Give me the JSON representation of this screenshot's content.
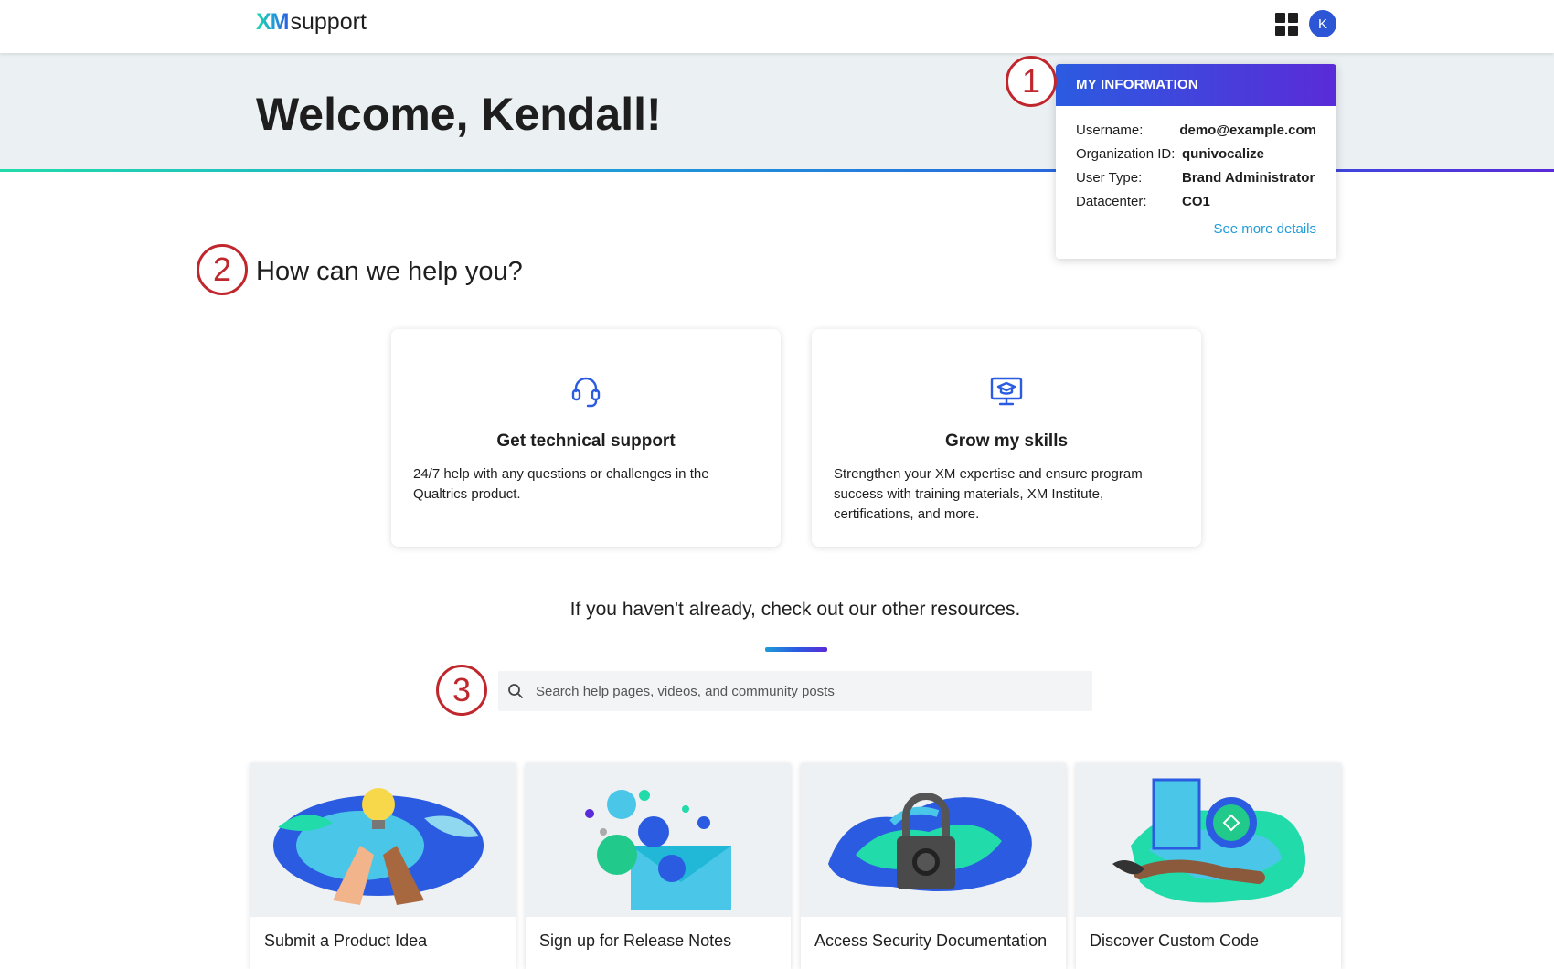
{
  "header": {
    "logo_xm": "XM",
    "logo_text": "support",
    "avatar_initial": "K"
  },
  "hero": {
    "welcome": "Welcome, Kendall!"
  },
  "my_information": {
    "title": "MY INFORMATION",
    "rows": [
      {
        "label": "Username:",
        "value": "demo@example.com"
      },
      {
        "label": "Organization ID:",
        "value": "qunivocalize"
      },
      {
        "label": "User Type:",
        "value": "Brand Administrator"
      },
      {
        "label": "Datacenter:",
        "value": "CO1"
      }
    ],
    "see_more": "See more details"
  },
  "callouts": [
    "1",
    "2",
    "3"
  ],
  "help": {
    "title": "How can we help you?",
    "cards": [
      {
        "title": "Get technical support",
        "desc": "24/7 help with any questions or challenges in the Qualtrics product.",
        "icon": "headset-icon"
      },
      {
        "title": "Grow my skills",
        "desc": "Strengthen your XM expertise and ensure program success with training materials, XM Institute, certifications, and more.",
        "icon": "training-monitor-icon"
      }
    ]
  },
  "resources": {
    "heading": "If you haven't already, check out our other resources.",
    "search_placeholder": "Search help pages, videos, and community posts",
    "tiles": [
      {
        "label": "Submit a Product Idea"
      },
      {
        "label": "Sign up for Release Notes"
      },
      {
        "label": "Access Security Documentation"
      },
      {
        "label": "Discover Custom Code"
      }
    ]
  },
  "colors": {
    "accent_blue": "#2b5be0",
    "accent_purple": "#5a2bd8",
    "link": "#1f9bd8",
    "callout_red": "#c0272d"
  }
}
